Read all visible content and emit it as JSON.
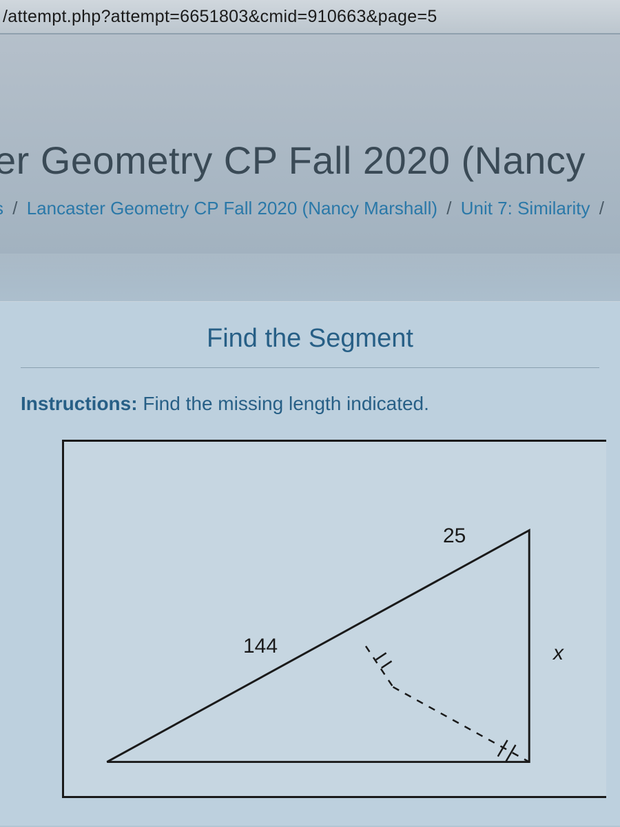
{
  "url_fragment": "/attempt.php?attempt=6651803&cmid=910663&page=5",
  "page_title": "er Geometry CP Fall 2020 (Nancy",
  "breadcrumb": {
    "prefix": "s",
    "course": "Lancaster Geometry CP Fall 2020 (Nancy Marshall)",
    "unit": "Unit 7: Similarity",
    "trailing_sep": "/"
  },
  "question": {
    "title": "Find the Segment",
    "instructions_label": "Instructions:",
    "instructions_text": " Find the missing length indicated."
  },
  "figure": {
    "label_hyp": "144",
    "label_top": "25",
    "label_right": "x"
  }
}
